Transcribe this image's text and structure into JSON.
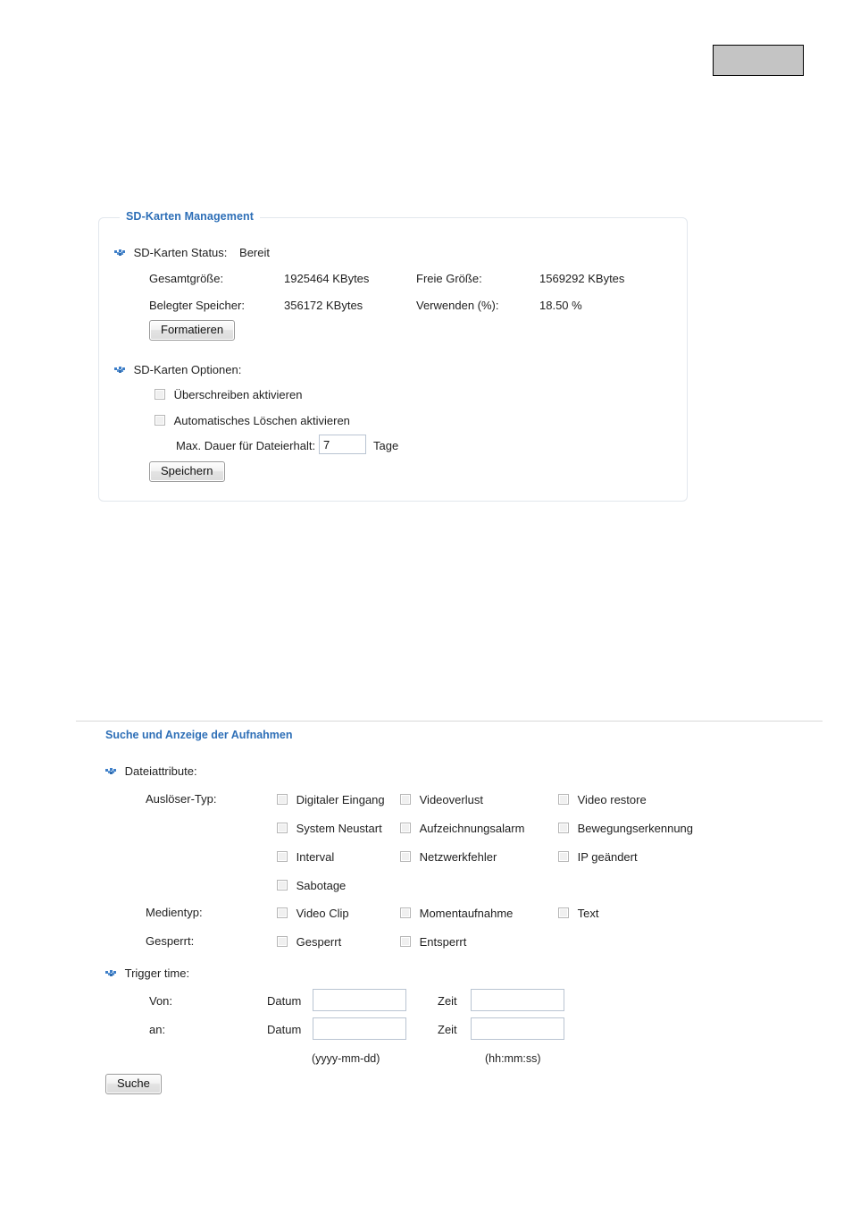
{
  "page": {
    "top_placeholder_color": "#c4c4c4"
  },
  "sd_management": {
    "legend": "SD-Karten Management",
    "status": {
      "label": "SD-Karten Status:",
      "value": "Bereit"
    },
    "stats": [
      {
        "label": "Gesamtgröße:",
        "value": "1925464  KBytes"
      },
      {
        "label": "Freie Größe:",
        "value": "1569292  KBytes"
      },
      {
        "label": "Belegter Speicher:",
        "value": "356172  KBytes"
      },
      {
        "label": "Verwenden (%):",
        "value": "18.50 %"
      }
    ],
    "format_button": "Formatieren",
    "options": {
      "heading": "SD-Karten Optionen:",
      "overwrite": {
        "label": "Überschreiben aktivieren",
        "checked": false
      },
      "autodelete": {
        "label": "Automatisches Löschen aktivieren",
        "checked": false
      },
      "max_duration": {
        "label": "Max. Dauer für Dateierhalt:",
        "value": "7",
        "unit": "Tage"
      },
      "save_button": "Speichern"
    }
  },
  "search_section": {
    "title": "Suche und Anzeige der Aufnahmen",
    "file_attributes_heading": "Dateiattribute:",
    "trigger_type_label": "Auslöser-Typ:",
    "trigger_types": [
      {
        "label": "Digitaler Eingang",
        "checked": false
      },
      {
        "label": "Videoverlust",
        "checked": false
      },
      {
        "label": "Video restore",
        "checked": false
      },
      {
        "label": "System Neustart",
        "checked": false
      },
      {
        "label": "Aufzeichnungsalarm",
        "checked": false
      },
      {
        "label": "Bewegungserkennung",
        "checked": false
      },
      {
        "label": "Interval",
        "checked": false
      },
      {
        "label": "Netzwerkfehler",
        "checked": false
      },
      {
        "label": "IP geändert",
        "checked": false
      },
      {
        "label": "Sabotage",
        "checked": false
      }
    ],
    "media_type_label": "Medientyp:",
    "media_types": [
      {
        "label": "Video Clip",
        "checked": false
      },
      {
        "label": "Momentaufnahme",
        "checked": false
      },
      {
        "label": "Text",
        "checked": false
      }
    ],
    "locked_label": "Gesperrt:",
    "locked_options": [
      {
        "label": "Gesperrt",
        "checked": false
      },
      {
        "label": "Entsperrt",
        "checked": false
      }
    ],
    "trigger_time_heading": "Trigger time:",
    "from_label": "Von:",
    "to_label": "an:",
    "date_label": "Datum",
    "time_label": "Zeit",
    "from_date": "",
    "from_time": "",
    "to_date": "",
    "to_time": "",
    "date_format_hint": "(yyyy-mm-dd)",
    "time_format_hint": "(hh:mm:ss)",
    "search_button": "Suche"
  }
}
